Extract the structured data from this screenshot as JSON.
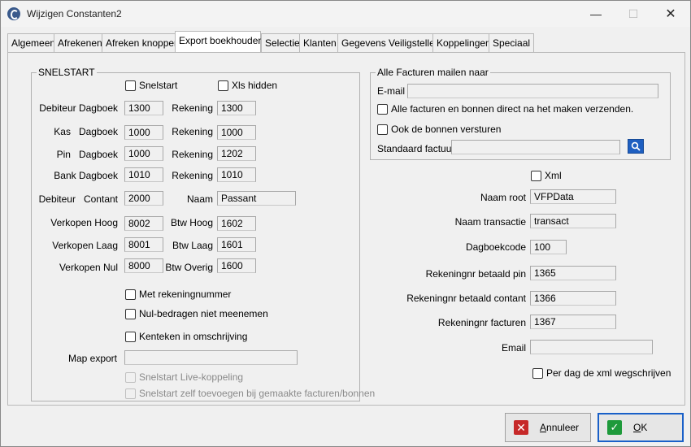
{
  "window": {
    "title": "Wijzigen Constanten2"
  },
  "tabs": [
    "Algemeen",
    "Afrekenen",
    "Afreken knoppen",
    "Export boekhouden",
    "Selectie",
    "Klanten",
    "Gegevens Veiligstellen",
    "Koppelingen",
    "Speciaal"
  ],
  "active_tab": "Export boekhouden",
  "snelstart": {
    "group_title": "SNELSTART",
    "chk_snelstart": "Snelstart",
    "chk_xls_hidden": "Xls hidden",
    "rows": [
      {
        "label": "Debiteur Dagboek",
        "value": "1300",
        "rek_label": "Rekening",
        "rek_value": "1300"
      },
      {
        "label": "Kas   Dagboek",
        "value": "1000",
        "rek_label": "Rekening",
        "rek_value": "1000"
      },
      {
        "label": "Pin   Dagboek",
        "value": "1000",
        "rek_label": "Rekening",
        "rek_value": "1202"
      },
      {
        "label": "Bank Dagboek",
        "value": "1010",
        "rek_label": "Rekening",
        "rek_value": "1010"
      },
      {
        "label": "Debiteur   Contant",
        "value": "2000",
        "rek_label": "Naam",
        "rek_value": "Passant"
      },
      {
        "label": "Verkopen Hoog",
        "value": "8002",
        "rek_label": "Btw Hoog",
        "rek_value": "1602"
      },
      {
        "label": "Verkopen Laag",
        "value": "8001",
        "rek_label": "Btw Laag",
        "rek_value": "1601"
      },
      {
        "label": "Verkopen Nul",
        "value": "8000",
        "rek_label": "Btw Overig",
        "rek_value": "1600"
      }
    ],
    "chk_met_rekeningnummer": "Met rekeningnummer",
    "chk_nul_bedragen": "Nul-bedragen niet meenemen",
    "chk_kenteken": "Kenteken in omschrijving",
    "map_export_label": "Map export",
    "map_export_value": "",
    "chk_live_koppeling": "Snelstart Live-koppeling",
    "chk_zelf_toevoegen": "Snelstart zelf toevoegen bij gemaakte facturen/bonnen"
  },
  "mail": {
    "group_title": "Alle Facturen mailen naar",
    "email_label": "E-mail",
    "email_value": "",
    "chk_direct": "Alle facturen en bonnen direct na het maken verzenden.",
    "chk_bonnen": "Ook de bonnen versturen",
    "std_factuur_label": "Standaard factuur",
    "std_factuur_value": ""
  },
  "xml": {
    "chk_xml": "Xml",
    "naam_root_label": "Naam root",
    "naam_root_value": "VFPData",
    "naam_transactie_label": "Naam transactie",
    "naam_transactie_value": "transact",
    "dagboekcode_label": "Dagboekcode",
    "dagboekcode_value": "100",
    "rek_pin_label": "Rekeningnr betaald pin",
    "rek_pin_value": "1365",
    "rek_contant_label": "Rekeningnr betaald contant",
    "rek_contant_value": "1366",
    "rek_facturen_label": "Rekeningnr facturen",
    "rek_facturen_value": "1367",
    "email_label": "Email",
    "email_value": "",
    "chk_per_dag": "Per dag de xml wegschrijven"
  },
  "buttons": {
    "cancel_rest": "nnuleer",
    "cancel_first": "A",
    "ok_first": "O",
    "ok_rest": "K"
  }
}
